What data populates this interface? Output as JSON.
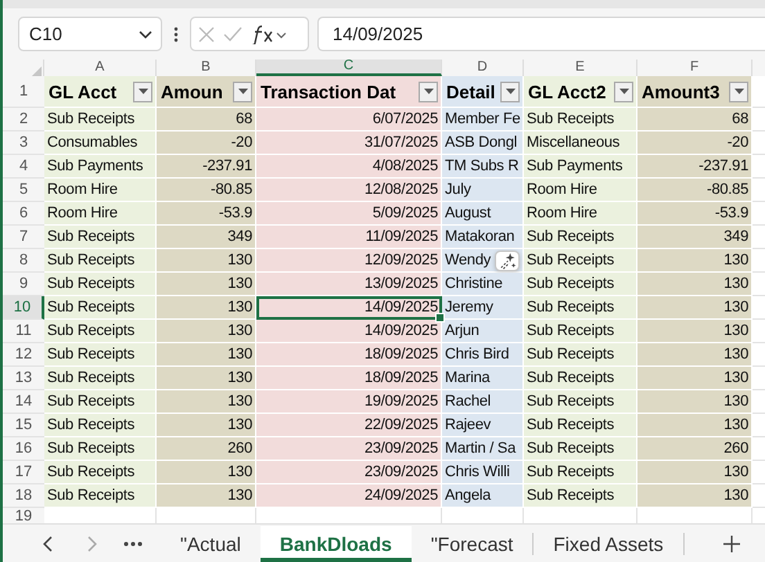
{
  "name_box": {
    "value": "C10"
  },
  "formula_bar": {
    "value": "14/09/2025"
  },
  "columns": [
    {
      "letter": "A",
      "selected": false,
      "color": "#ebf1de",
      "kind": "text"
    },
    {
      "letter": "B",
      "selected": false,
      "color": "#ddd9c4",
      "kind": "number"
    },
    {
      "letter": "C",
      "selected": true,
      "color": "#f2dcdb",
      "kind": "number"
    },
    {
      "letter": "D",
      "selected": false,
      "color": "#dce6f1",
      "kind": "text"
    },
    {
      "letter": "E",
      "selected": false,
      "color": "#ebf1de",
      "kind": "text"
    },
    {
      "letter": "F",
      "selected": false,
      "color": "#ddd9c4",
      "kind": "number"
    }
  ],
  "header_row": {
    "number": "1",
    "cells": [
      "GL Acct",
      "Amoun",
      "Transaction Dat",
      "Detail",
      "GL Acct2",
      "Amount3"
    ]
  },
  "rows": [
    {
      "number": "2",
      "selected": false,
      "cells": [
        "Sub Receipts",
        "68",
        "6/07/2025",
        "Member Fe",
        "Sub Receipts",
        "68"
      ]
    },
    {
      "number": "3",
      "selected": false,
      "cells": [
        "Consumables",
        "-20",
        "31/07/2025",
        "ASB Dongl",
        "Miscellaneous",
        "-20"
      ]
    },
    {
      "number": "4",
      "selected": false,
      "cells": [
        "Sub Payments",
        "-237.91",
        "4/08/2025",
        "TM Subs R",
        "Sub Payments",
        "-237.91"
      ]
    },
    {
      "number": "5",
      "selected": false,
      "cells": [
        "Room Hire",
        "-80.85",
        "12/08/2025",
        "July",
        "Room Hire",
        "-80.85"
      ]
    },
    {
      "number": "6",
      "selected": false,
      "cells": [
        "Room Hire",
        "-53.9",
        "5/09/2025",
        "August",
        "Room Hire",
        "-53.9"
      ]
    },
    {
      "number": "7",
      "selected": false,
      "cells": [
        "Sub Receipts",
        "349",
        "11/09/2025",
        "Matakoran",
        "Sub Receipts",
        "349"
      ]
    },
    {
      "number": "8",
      "selected": false,
      "cells": [
        "Sub Receipts",
        "130",
        "12/09/2025",
        "Wendy",
        "Sub Receipts",
        "130"
      ]
    },
    {
      "number": "9",
      "selected": false,
      "cells": [
        "Sub Receipts",
        "130",
        "13/09/2025",
        "Christine",
        "Sub Receipts",
        "130"
      ]
    },
    {
      "number": "10",
      "selected": true,
      "cells": [
        "Sub Receipts",
        "130",
        "14/09/2025",
        "Jeremy",
        "Sub Receipts",
        "130"
      ]
    },
    {
      "number": "11",
      "selected": false,
      "cells": [
        "Sub Receipts",
        "130",
        "14/09/2025",
        "Arjun",
        "Sub Receipts",
        "130"
      ]
    },
    {
      "number": "12",
      "selected": false,
      "cells": [
        "Sub Receipts",
        "130",
        "18/09/2025",
        "Chris Bird",
        "Sub Receipts",
        "130"
      ]
    },
    {
      "number": "13",
      "selected": false,
      "cells": [
        "Sub Receipts",
        "130",
        "18/09/2025",
        "Marina",
        "Sub Receipts",
        "130"
      ]
    },
    {
      "number": "14",
      "selected": false,
      "cells": [
        "Sub Receipts",
        "130",
        "19/09/2025",
        "Rachel",
        "Sub Receipts",
        "130"
      ]
    },
    {
      "number": "15",
      "selected": false,
      "cells": [
        "Sub Receipts",
        "130",
        "22/09/2025",
        "Rajeev",
        "Sub Receipts",
        "130"
      ]
    },
    {
      "number": "16",
      "selected": false,
      "cells": [
        "Sub Receipts",
        "260",
        "23/09/2025",
        "Martin / Sa",
        "Sub Receipts",
        "260"
      ]
    },
    {
      "number": "17",
      "selected": false,
      "cells": [
        "Sub Receipts",
        "130",
        "23/09/2025",
        "Chris Willi",
        "Sub Receipts",
        "130"
      ]
    },
    {
      "number": "18",
      "selected": false,
      "cells": [
        "Sub Receipts",
        "130",
        "24/09/2025",
        "Angela",
        "Sub Receipts",
        "130"
      ]
    },
    {
      "number": "19",
      "selected": false
    }
  ],
  "sheet_tabs": [
    {
      "label": "\"Actual",
      "selected": false
    },
    {
      "label": "BankDloads",
      "selected": true
    },
    {
      "label": "\"Forecast",
      "selected": false
    },
    {
      "label": "Fixed Assets",
      "selected": false
    }
  ]
}
